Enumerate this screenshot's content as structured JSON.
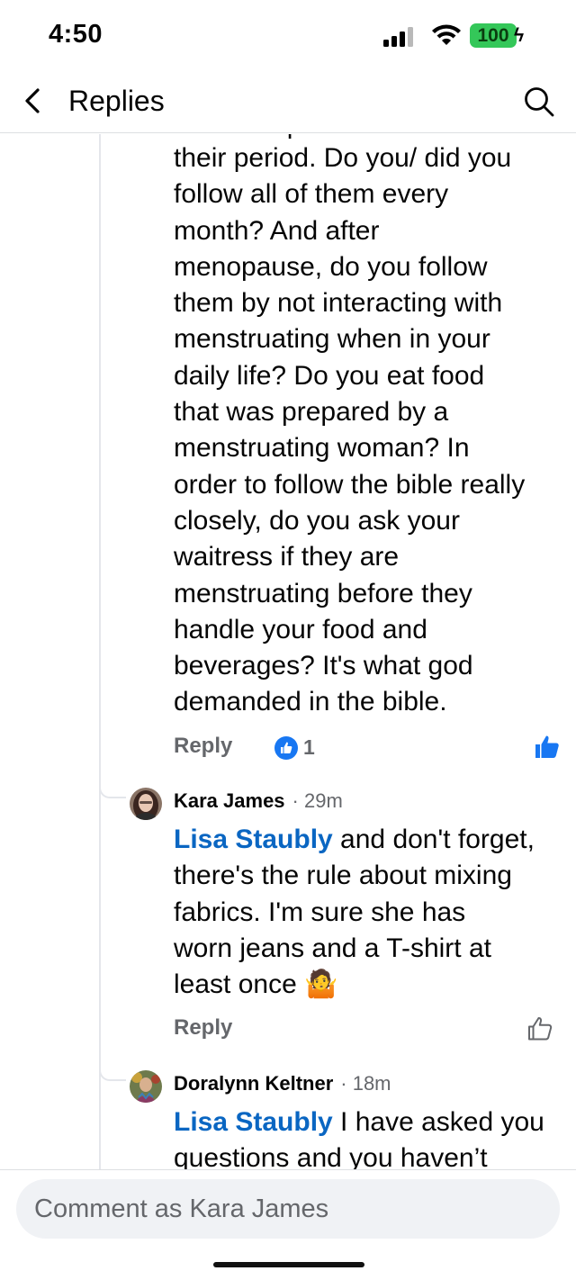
{
  "status_bar": {
    "time": "4:50",
    "battery_level": "100",
    "battery_color": "#34c759",
    "icons": [
      "signal-icon",
      "wifi-icon",
      "battery-icon"
    ]
  },
  "header": {
    "title": "Replies",
    "icons": [
      "back-chevron-icon",
      "search-icon"
    ]
  },
  "thread": {
    "first_comment": {
      "cut_off_line": "woman's period rules when on",
      "lines": [
        "their period. Do you/ did you",
        "follow all of them every",
        "month? And after",
        "menopause, do you follow",
        "them by not interacting with",
        "menstruating when in your",
        "daily life? Do you eat food",
        "that was prepared by a",
        "menstruating woman? In",
        "order to follow the bible really",
        "closely, do you ask your",
        "waitress if they are",
        "menstruating before they",
        "handle your food and",
        "beverages? It's what god",
        "demanded in the bible."
      ],
      "reply_label": "Reply",
      "reaction_count": "1",
      "liked": true,
      "accent_color": "#1877f2"
    },
    "comments": [
      {
        "author": "Kara James",
        "time": "· 29m",
        "mention": "Lisa Staubly",
        "first_line_rest": " and don't forget,",
        "lines": [
          "there's the rule about mixing",
          "fabrics. I'm sure she has",
          "worn jeans and a T-shirt at",
          "least once 🤷"
        ],
        "reply_label": "Reply",
        "liked": false
      },
      {
        "author": "Doralynn Keltner",
        "time": "· 18m",
        "mention": "Lisa Staubly",
        "first_line_rest": " I have asked you",
        "lines": [
          "questions and you haven’t"
        ]
      }
    ]
  },
  "composer": {
    "placeholder": "Comment as Kara James"
  }
}
